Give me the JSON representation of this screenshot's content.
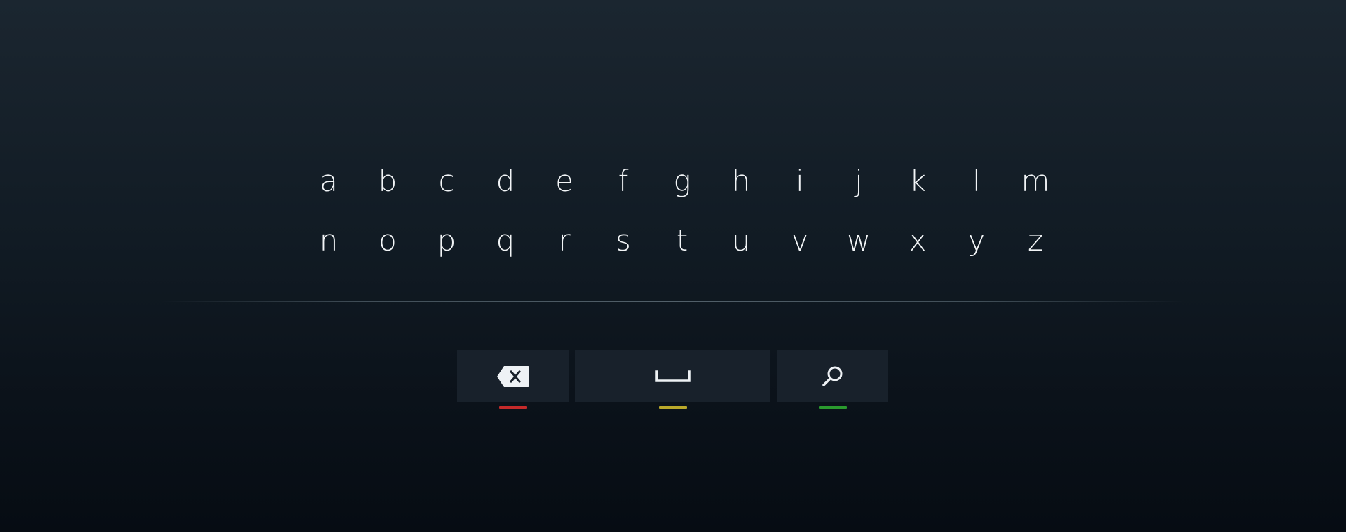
{
  "keyboard": {
    "rows": [
      [
        "a",
        "b",
        "c",
        "d",
        "e",
        "f",
        "g",
        "h",
        "i",
        "j",
        "k",
        "l",
        "m"
      ],
      [
        "n",
        "o",
        "p",
        "q",
        "r",
        "s",
        "t",
        "u",
        "v",
        "w",
        "x",
        "y",
        "z"
      ]
    ],
    "actions": [
      {
        "name": "backspace",
        "icon": "backspace-icon",
        "hint_color": "#c42a2a"
      },
      {
        "name": "space",
        "icon": "space-icon",
        "hint_color": "#b9a82a"
      },
      {
        "name": "search",
        "icon": "search-icon",
        "hint_color": "#2a9a2e"
      }
    ]
  },
  "colors": {
    "background_top": "#1b2630",
    "background_bottom": "#060c13",
    "key_background": "#18212b",
    "text": "#f2f5f7"
  }
}
